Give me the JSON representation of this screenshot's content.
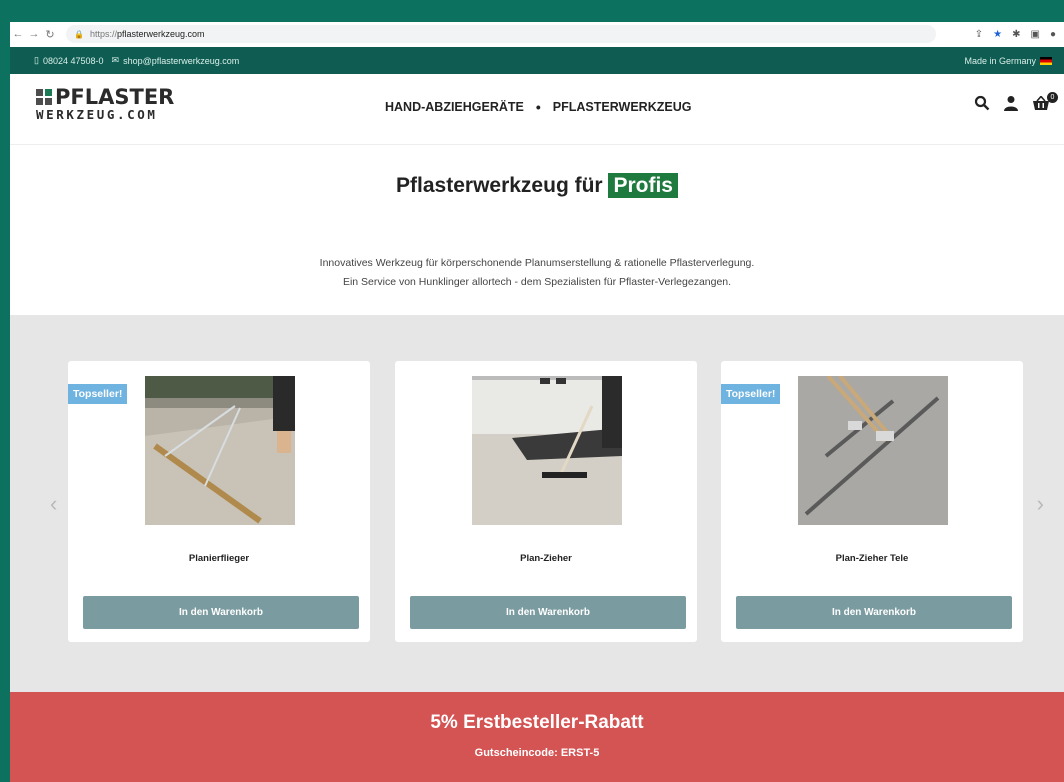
{
  "browser": {
    "url_proto": "https://",
    "url_host": "pflasterwerkzeug.com"
  },
  "topbar": {
    "phone": "08024 47508-0",
    "email": "shop@pflasterwerkzeug.com",
    "made_in": "Made in Germany"
  },
  "header": {
    "logo_main": "PFLASTER",
    "logo_sub": "WERKZEUG.COM",
    "nav": [
      "HAND-ABZIEHGERÄTE",
      "PFLASTERWERKZEUG"
    ],
    "nav_separator": "•",
    "cart_count": "0"
  },
  "hero": {
    "title_prefix": "Pflasterwerkzeug für",
    "title_highlight": "Profis",
    "line1": "Innovatives Werkzeug für körperschonende Planumserstellung & rationelle Pflasterverlegung.",
    "line2": "Ein Service von Hunklinger allortech - dem Spezialisten für Pflaster-Verlegezangen."
  },
  "products": [
    {
      "name": "Planierflieger",
      "badge": "Topseller!",
      "button": "In den Warenkorb"
    },
    {
      "name": "Plan-Zieher",
      "badge": "",
      "button": "In den Warenkorb"
    },
    {
      "name": "Plan-Zieher Tele",
      "badge": "Topseller!",
      "button": "In den Warenkorb"
    }
  ],
  "promo": {
    "title": "5% Erstbesteller-Rabatt",
    "code": "Gutscheincode: ERST-5"
  },
  "colors": {
    "brand_green": "#0f5d52",
    "highlight_green": "#1e7a3e",
    "button_grey": "#7a9ba0",
    "badge_blue": "#6fb3e0",
    "promo_red": "#d45353"
  }
}
